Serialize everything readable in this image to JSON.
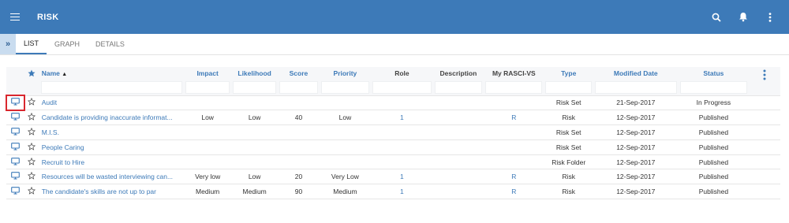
{
  "app": {
    "title": "RISK"
  },
  "tabs": [
    {
      "label": "LIST"
    },
    {
      "label": "GRAPH"
    },
    {
      "label": "DETAILS"
    }
  ],
  "collapse_glyph": "»",
  "columns": {
    "name": "Name",
    "impact": "Impact",
    "likelihood": "Likelihood",
    "score": "Score",
    "priority": "Priority",
    "role": "Role",
    "description": "Description",
    "rasci": "My RASCI-VS",
    "type": "Type",
    "modified": "Modified Date",
    "status": "Status"
  },
  "sort_indicator": "▲",
  "rows": [
    {
      "name": "Audit",
      "impact": "",
      "likelihood": "",
      "score": "",
      "priority": "",
      "role": "",
      "description": "",
      "rasci": "",
      "type": "Risk Set",
      "modified": "21-Sep-2017",
      "status": "In Progress"
    },
    {
      "name": "Candidate is providing inaccurate informat...",
      "impact": "Low",
      "likelihood": "Low",
      "score": "40",
      "priority": "Low",
      "role": "1",
      "description": "",
      "rasci": "R",
      "type": "Risk",
      "modified": "12-Sep-2017",
      "status": "Published"
    },
    {
      "name": "M.I.S.",
      "impact": "",
      "likelihood": "",
      "score": "",
      "priority": "",
      "role": "",
      "description": "",
      "rasci": "",
      "type": "Risk Set",
      "modified": "12-Sep-2017",
      "status": "Published"
    },
    {
      "name": "People Caring",
      "impact": "",
      "likelihood": "",
      "score": "",
      "priority": "",
      "role": "",
      "description": "",
      "rasci": "",
      "type": "Risk Set",
      "modified": "12-Sep-2017",
      "status": "Published"
    },
    {
      "name": "Recruit to Hire",
      "impact": "",
      "likelihood": "",
      "score": "",
      "priority": "",
      "role": "",
      "description": "",
      "rasci": "",
      "type": "Risk Folder",
      "modified": "12-Sep-2017",
      "status": "Published"
    },
    {
      "name": "Resources will be wasted interviewing can...",
      "impact": "Very low",
      "likelihood": "Low",
      "score": "20",
      "priority": "Very Low",
      "role": "1",
      "description": "",
      "rasci": "R",
      "type": "Risk",
      "modified": "12-Sep-2017",
      "status": "Published"
    },
    {
      "name": "The candidate's skills are not up to par",
      "impact": "Medium",
      "likelihood": "Medium",
      "score": "90",
      "priority": "Medium",
      "role": "1",
      "description": "",
      "rasci": "R",
      "type": "Risk",
      "modified": "12-Sep-2017",
      "status": "Published"
    }
  ],
  "colors": {
    "topbar": "#3d7ab8",
    "link": "#3d7ab8",
    "highlight": "#d9272e"
  }
}
